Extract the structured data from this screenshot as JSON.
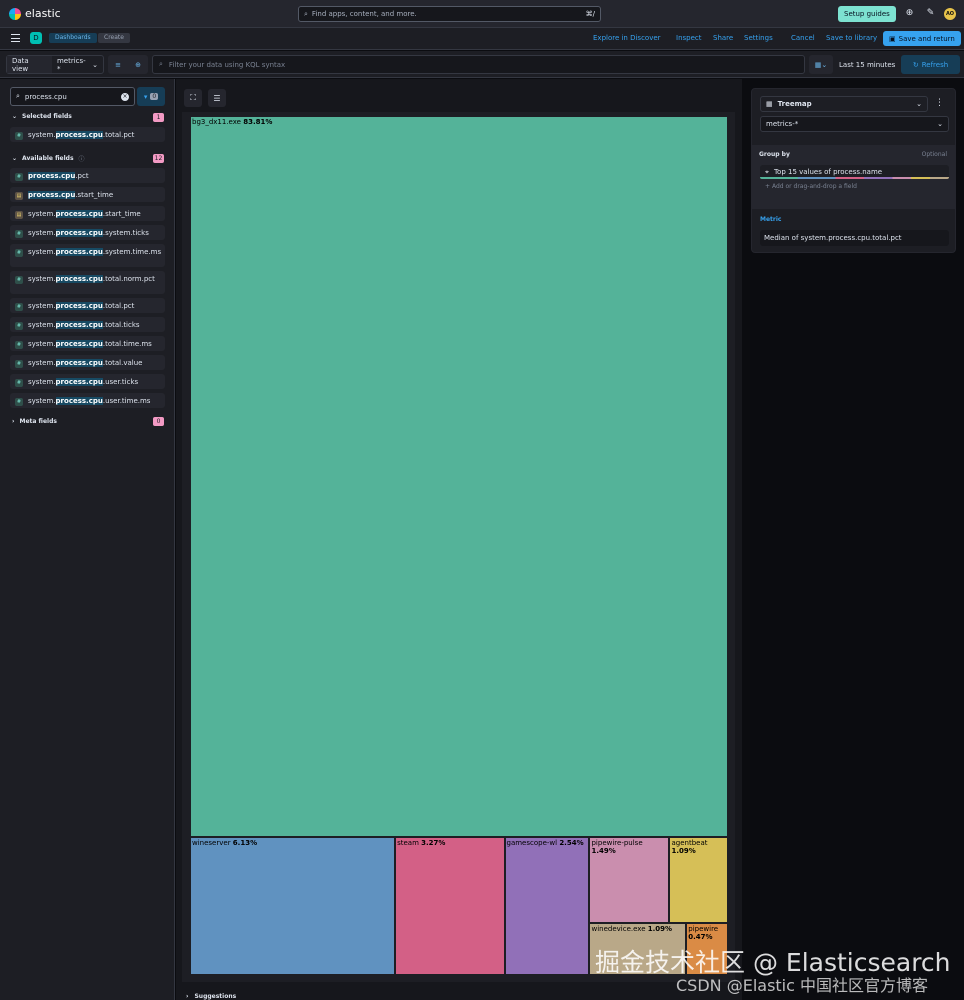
{
  "topbar": {
    "brand": "elastic",
    "search_placeholder": "Find apps, content, and more.",
    "search_shortcut": "⌘/",
    "setup_guides": "Setup guides",
    "avatar_initials": "AO"
  },
  "nav": {
    "space_letter": "D",
    "breadcrumbs": [
      "Dashboards",
      "Create"
    ],
    "links": [
      "Explore in Discover",
      "Inspect",
      "Share",
      "Settings",
      "Cancel",
      "Save to library"
    ],
    "save_and_return": "Save and return"
  },
  "query": {
    "data_view_label": "Data view",
    "data_view_value": "metrics-*",
    "kql_placeholder": "Filter your data using KQL syntax",
    "time_range": "Last 15 minutes",
    "refresh": "Refresh"
  },
  "fields": {
    "search_value": "process.cpu",
    "filter_count": "0",
    "selected_header": "Selected fields",
    "selected_count": "1",
    "selected": [
      {
        "pre": "system.",
        "match": "process.cpu",
        "post": ".total.pct",
        "type": "num"
      }
    ],
    "available_header": "Available fields",
    "available_count": "12",
    "available": [
      {
        "pre": "",
        "match": "process.cpu",
        "post": ".pct",
        "type": "num"
      },
      {
        "pre": "",
        "match": "process.cpu",
        "post": ".start_time",
        "type": "date"
      },
      {
        "pre": "system.",
        "match": "process.cpu",
        "post": ".start_time",
        "type": "date"
      },
      {
        "pre": "system.",
        "match": "process.cpu",
        "post": ".system.ticks",
        "type": "num"
      },
      {
        "pre": "system.",
        "match": "process.cpu",
        "post": ".system.time.ms",
        "type": "num"
      },
      {
        "pre": "system.",
        "match": "process.cpu",
        "post": ".total.norm.pct",
        "type": "num"
      },
      {
        "pre": "system.",
        "match": "process.cpu",
        "post": ".total.pct",
        "type": "num"
      },
      {
        "pre": "system.",
        "match": "process.cpu",
        "post": ".total.ticks",
        "type": "num"
      },
      {
        "pre": "system.",
        "match": "process.cpu",
        "post": ".total.time.ms",
        "type": "num"
      },
      {
        "pre": "system.",
        "match": "process.cpu",
        "post": ".total.value",
        "type": "num"
      },
      {
        "pre": "system.",
        "match": "process.cpu",
        "post": ".user.ticks",
        "type": "num"
      },
      {
        "pre": "system.",
        "match": "process.cpu",
        "post": ".user.time.ms",
        "type": "num"
      }
    ],
    "meta_header": "Meta fields",
    "meta_count": "0"
  },
  "config": {
    "chart_type": "Treemap",
    "data_view": "metrics-*",
    "group_by_label": "Group by",
    "optional_label": "Optional",
    "dimension": "Top 15 values of process.name",
    "add_field": "Add or drag-and-drop a field",
    "metric_label": "Metric",
    "metric_value": "Median of system.process.cpu.total.pct"
  },
  "suggestions_label": "Suggestions",
  "chart_data": {
    "type": "treemap",
    "items": [
      {
        "name": "bg3_dx11.exe",
        "label": "83.81%",
        "value": 83.81,
        "color": "#54b399"
      },
      {
        "name": "wineserver",
        "label": "6.13%",
        "value": 6.13,
        "color": "#6092c0"
      },
      {
        "name": "steam",
        "label": "3.27%",
        "value": 3.27,
        "color": "#d36086"
      },
      {
        "name": "gamescope-wl",
        "label": "2.54%",
        "value": 2.54,
        "color": "#9170b8"
      },
      {
        "name": "pipewire-pulse",
        "label": "1.49%",
        "value": 1.49,
        "color": "#ca8eae"
      },
      {
        "name": "agentbeat",
        "label": "1.09%",
        "value": 1.09,
        "color": "#d6bf57"
      },
      {
        "name": "winedevice.exe",
        "label": "1.09%",
        "value": 1.09,
        "color": "#b9a888"
      },
      {
        "name": "pipewire",
        "label": "0.47%",
        "value": 0.47,
        "color": "#da8b45"
      }
    ]
  },
  "watermark": {
    "line1": "掘金技术社区 @ Elasticsearch",
    "line2": "CSDN @Elastic 中国社区官方博客"
  }
}
